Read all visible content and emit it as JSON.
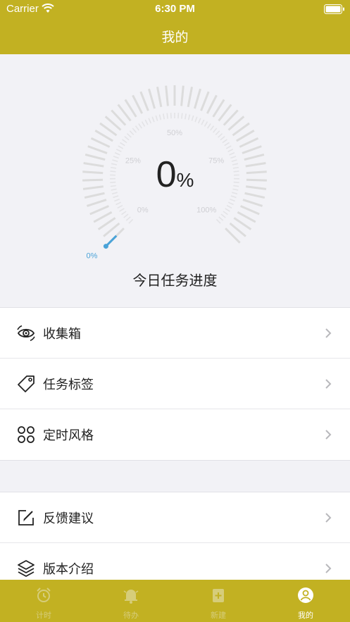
{
  "status_bar": {
    "carrier": "Carrier",
    "time": "6:30 PM"
  },
  "nav": {
    "title": "我的"
  },
  "gauge": {
    "value": "0",
    "unit": "%",
    "progress": 0,
    "scale_labels": [
      "0%",
      "25%",
      "50%",
      "75%",
      "100%"
    ],
    "pointer_label": "0%",
    "caption": "今日任务进度",
    "accent_color": "#4aa3d8",
    "tick_color": "#dcdcdc"
  },
  "menu_group_1": [
    {
      "label": "收集箱",
      "icon": "eye-icon"
    },
    {
      "label": "任务标签",
      "icon": "tag-icon"
    },
    {
      "label": "定时风格",
      "icon": "grid-icon"
    }
  ],
  "menu_group_2": [
    {
      "label": "反馈建议",
      "icon": "edit-icon"
    },
    {
      "label": "版本介绍",
      "icon": "layers-icon"
    }
  ],
  "tabbar": {
    "color": "#c2b122",
    "tabs": [
      {
        "label": "计时",
        "icon": "alarm-clock-icon",
        "active": false
      },
      {
        "label": "待办",
        "icon": "bell-icon",
        "active": false
      },
      {
        "label": "新建",
        "icon": "new-note-icon",
        "active": false
      },
      {
        "label": "我的",
        "icon": "user-icon",
        "active": true
      }
    ]
  }
}
